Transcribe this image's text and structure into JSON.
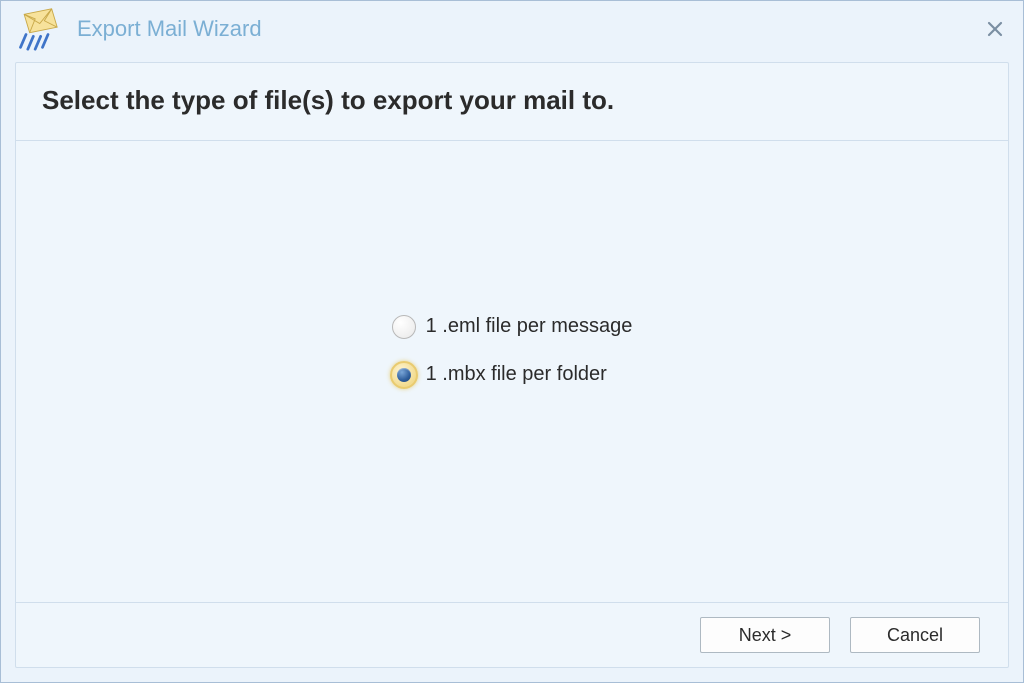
{
  "title": "Export Mail Wizard",
  "heading": "Select the type of file(s) to export your mail to.",
  "options": {
    "eml": "1 .eml file per message",
    "mbx": "1 .mbx file per folder"
  },
  "selected_option": "mbx",
  "buttons": {
    "next": "Next >",
    "cancel": "Cancel"
  }
}
